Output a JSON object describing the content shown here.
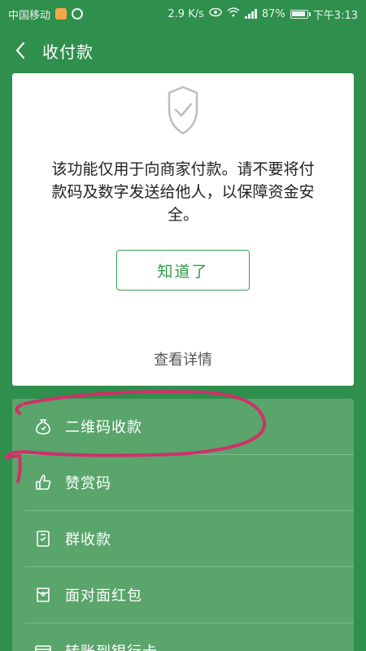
{
  "status_bar": {
    "carrier": "中国移动",
    "speed": "2.9 K/s",
    "battery": "87%",
    "time": "下午3:13"
  },
  "header": {
    "title": "收付款"
  },
  "card": {
    "notice": "该功能仅用于向商家付款。请不要将付款码及数字发送给他人，以保障资金安全。",
    "ok_label": "知道了",
    "details_label": "查看详情"
  },
  "menu": {
    "items": [
      {
        "label": "二维码收款",
        "icon": "money-bag-icon"
      },
      {
        "label": "赞赏码",
        "icon": "thumbs-up-icon"
      },
      {
        "label": "群收款",
        "icon": "group-collect-icon"
      },
      {
        "label": "面对面红包",
        "icon": "red-packet-icon"
      },
      {
        "label": "转账到银行卡",
        "icon": "bank-card-icon"
      }
    ]
  },
  "colors": {
    "background": "#2f8f4d",
    "menu_bg": "#59a56b",
    "accent": "#35a24f",
    "annotation": "#d0306a"
  }
}
